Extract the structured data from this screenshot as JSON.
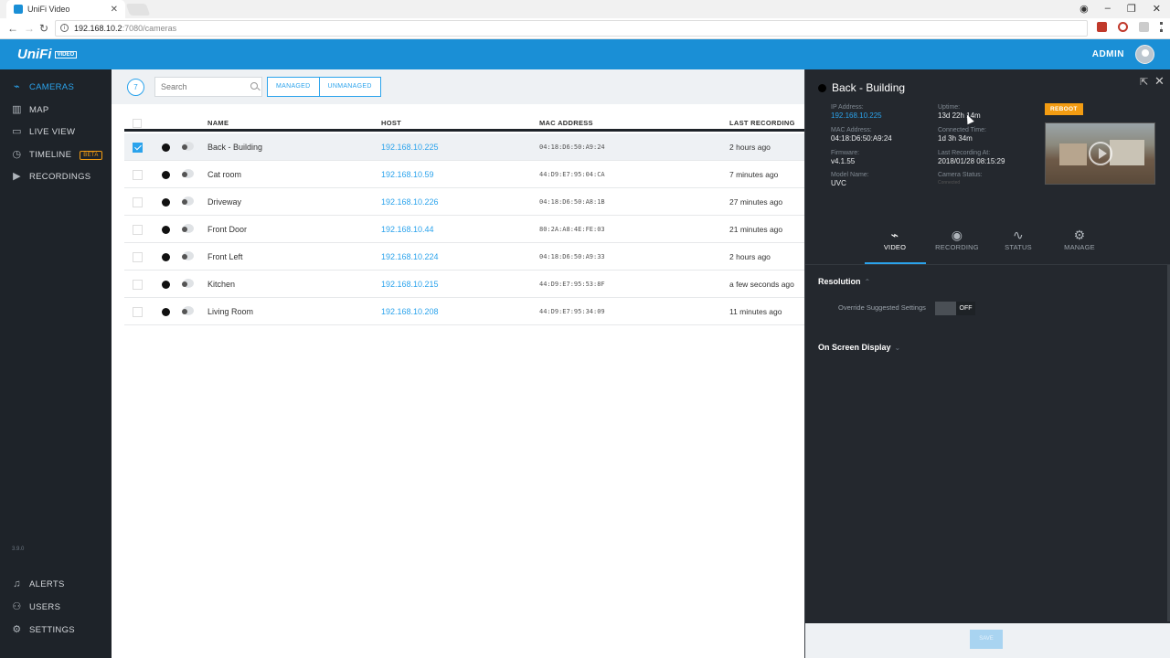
{
  "browser": {
    "tab_title": "UniFi Video",
    "url_host": "192.168.10.2",
    "url_path": ":7080/cameras"
  },
  "header": {
    "logo": "UniFi",
    "logo_tag": "VIDEO",
    "user": "ADMIN"
  },
  "sidebar": {
    "items": [
      {
        "label": "CAMERAS",
        "icon": "camera-icon"
      },
      {
        "label": "MAP",
        "icon": "map-icon"
      },
      {
        "label": "LIVE VIEW",
        "icon": "monitor-icon"
      },
      {
        "label": "TIMELINE",
        "icon": "clock-icon",
        "badge": "BETA"
      },
      {
        "label": "RECORDINGS",
        "icon": "play-icon"
      }
    ],
    "bottom_items": [
      {
        "label": "ALERTS",
        "icon": "bell-icon"
      },
      {
        "label": "USERS",
        "icon": "users-icon"
      },
      {
        "label": "SETTINGS",
        "icon": "gear-icon"
      }
    ],
    "version": "3.9.0"
  },
  "toolbar": {
    "count": "7",
    "search_placeholder": "Search",
    "filter_managed": "MANAGED",
    "filter_unmanaged": "UNMANAGED"
  },
  "table": {
    "columns": [
      "NAME",
      "HOST",
      "MAC ADDRESS",
      "LAST RECORDING"
    ],
    "rows": [
      {
        "name": "Back - Building",
        "host": "192.168.10.225",
        "mac": "04:18:D6:50:A9:24",
        "last": "2 hours ago",
        "selected": true
      },
      {
        "name": "Cat room",
        "host": "192.168.10.59",
        "mac": "44:D9:E7:95:04:CA",
        "last": "7 minutes ago"
      },
      {
        "name": "Driveway",
        "host": "192.168.10.226",
        "mac": "04:18:D6:50:A8:1B",
        "last": "27 minutes ago"
      },
      {
        "name": "Front Door",
        "host": "192.168.10.44",
        "mac": "80:2A:A8:4E:FE:03",
        "last": "21 minutes ago"
      },
      {
        "name": "Front Left",
        "host": "192.168.10.224",
        "mac": "04:18:D6:50:A9:33",
        "last": "2 hours ago"
      },
      {
        "name": "Kitchen",
        "host": "192.168.10.215",
        "mac": "44:D9:E7:95:53:8F",
        "last": "a few seconds ago"
      },
      {
        "name": "Living Room",
        "host": "192.168.10.208",
        "mac": "44:D9:E7:95:34:09",
        "last": "11 minutes ago"
      }
    ]
  },
  "panel": {
    "title": "Back - Building",
    "ip_label": "IP Address:",
    "ip": "192.168.10.225",
    "mac_label": "MAC Address:",
    "mac": "04:18:D6:50:A9:24",
    "fw_label": "Firmware:",
    "fw": "v4.1.55",
    "model_label": "Model Name:",
    "model": "UVC",
    "uptime_label": "Uptime:",
    "uptime": "13d 22h 14m",
    "conn_label": "Connected Time:",
    "conn": "1d 3h 34m",
    "lastrec_label": "Last Recording At:",
    "lastrec": "2018/01/28 08:15:29",
    "status_label": "Camera Status:",
    "status": "Connected",
    "reboot": "REBOOT",
    "tabs": [
      "VIDEO",
      "RECORDING",
      "STATUS",
      "MANAGE"
    ],
    "section_resolution": "Resolution",
    "override_label": "Override Suggested Settings",
    "toggle": "OFF",
    "section_osd": "On Screen Display",
    "save": "SAVE"
  },
  "colors": {
    "accent": "#1a8fd6",
    "link": "#2ba3ec",
    "sidebar_bg": "#1e2329",
    "panel_bg": "#24282e",
    "warning": "#f39c12"
  }
}
